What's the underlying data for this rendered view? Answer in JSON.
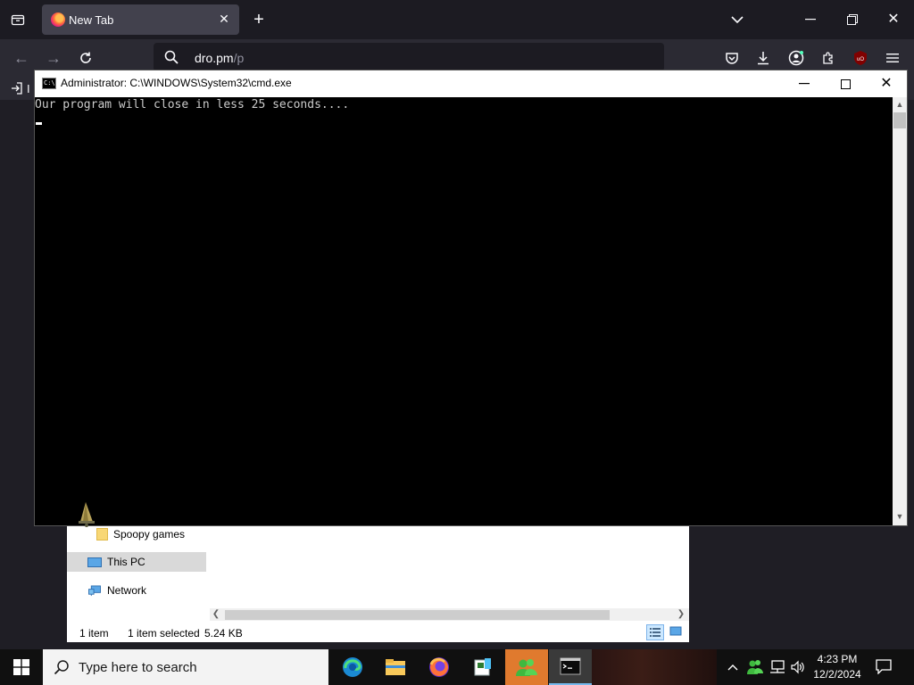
{
  "browser": {
    "tab": {
      "title": "New Tab"
    },
    "url": {
      "host": "dro.pm",
      "path": "/p"
    },
    "bookmark_label": "I"
  },
  "explorer": {
    "nav": {
      "spoopy": "Spoopy games",
      "thispc": "This PC",
      "network": "Network"
    },
    "status": {
      "count": "1 item",
      "selected": "1 item selected",
      "size": "5.24 KB"
    }
  },
  "cmd": {
    "title": "Administrator: C:\\WINDOWS\\System32\\cmd.exe",
    "output": "Our program will close in less 25 seconds...."
  },
  "taskbar": {
    "search_placeholder": "Type here to search",
    "time": "4:23 PM",
    "date": "12/2/2024"
  },
  "colors": {
    "firefox_toolbar": "#2b2a33",
    "taskbar_active_app": "#e07a2e",
    "console_bg": "#000000"
  }
}
